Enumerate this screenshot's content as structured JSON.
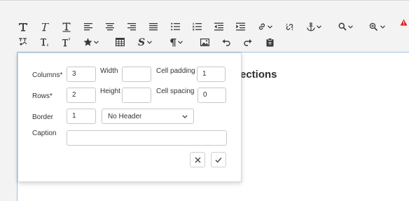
{
  "toolbar": {
    "row1": [
      {
        "icon": "bold-icon"
      },
      {
        "icon": "italic-icon"
      },
      {
        "icon": "underline-icon"
      },
      {
        "icon": "align-left-icon"
      },
      {
        "icon": "align-center-icon"
      },
      {
        "icon": "align-right-icon"
      },
      {
        "icon": "align-justify-icon"
      },
      {
        "icon": "bulleted-list-icon"
      },
      {
        "icon": "numbered-list-icon"
      },
      {
        "icon": "outdent-icon"
      },
      {
        "icon": "indent-icon"
      },
      {
        "icon": "link-icon"
      },
      {
        "icon": "unlink-icon"
      },
      {
        "icon": "anchor-icon"
      },
      {
        "icon": "search-icon"
      },
      {
        "icon": "find-replace-icon"
      }
    ],
    "row2": [
      {
        "icon": "clear-formatting-icon"
      },
      {
        "icon": "subscript-icon"
      },
      {
        "icon": "superscript-icon"
      },
      {
        "icon": "star-icon"
      },
      {
        "icon": "table-icon"
      },
      {
        "icon": "strikethrough-icon"
      },
      {
        "icon": "paragraph-icon"
      },
      {
        "icon": "image-icon"
      },
      {
        "icon": "undo-icon"
      },
      {
        "icon": "redo-icon"
      },
      {
        "icon": "paste-icon"
      }
    ],
    "warning_color": "#e02020"
  },
  "editor": {
    "visible_text": "ections",
    "border_color": "#9ec3e8"
  },
  "dialog": {
    "columns_label": "Columns*",
    "columns_value": "3",
    "width_label": "Width",
    "width_value": "",
    "cell_padding_label": "Cell padding",
    "cell_padding_value": "1",
    "rows_label": "Rows*",
    "rows_value": "2",
    "height_label": "Height",
    "height_value": "",
    "cell_spacing_label": "Cell spacing",
    "cell_spacing_value": "0",
    "border_label": "Border",
    "border_value": "1",
    "header_selected": "No Header",
    "caption_label": "Caption",
    "caption_value": ""
  }
}
